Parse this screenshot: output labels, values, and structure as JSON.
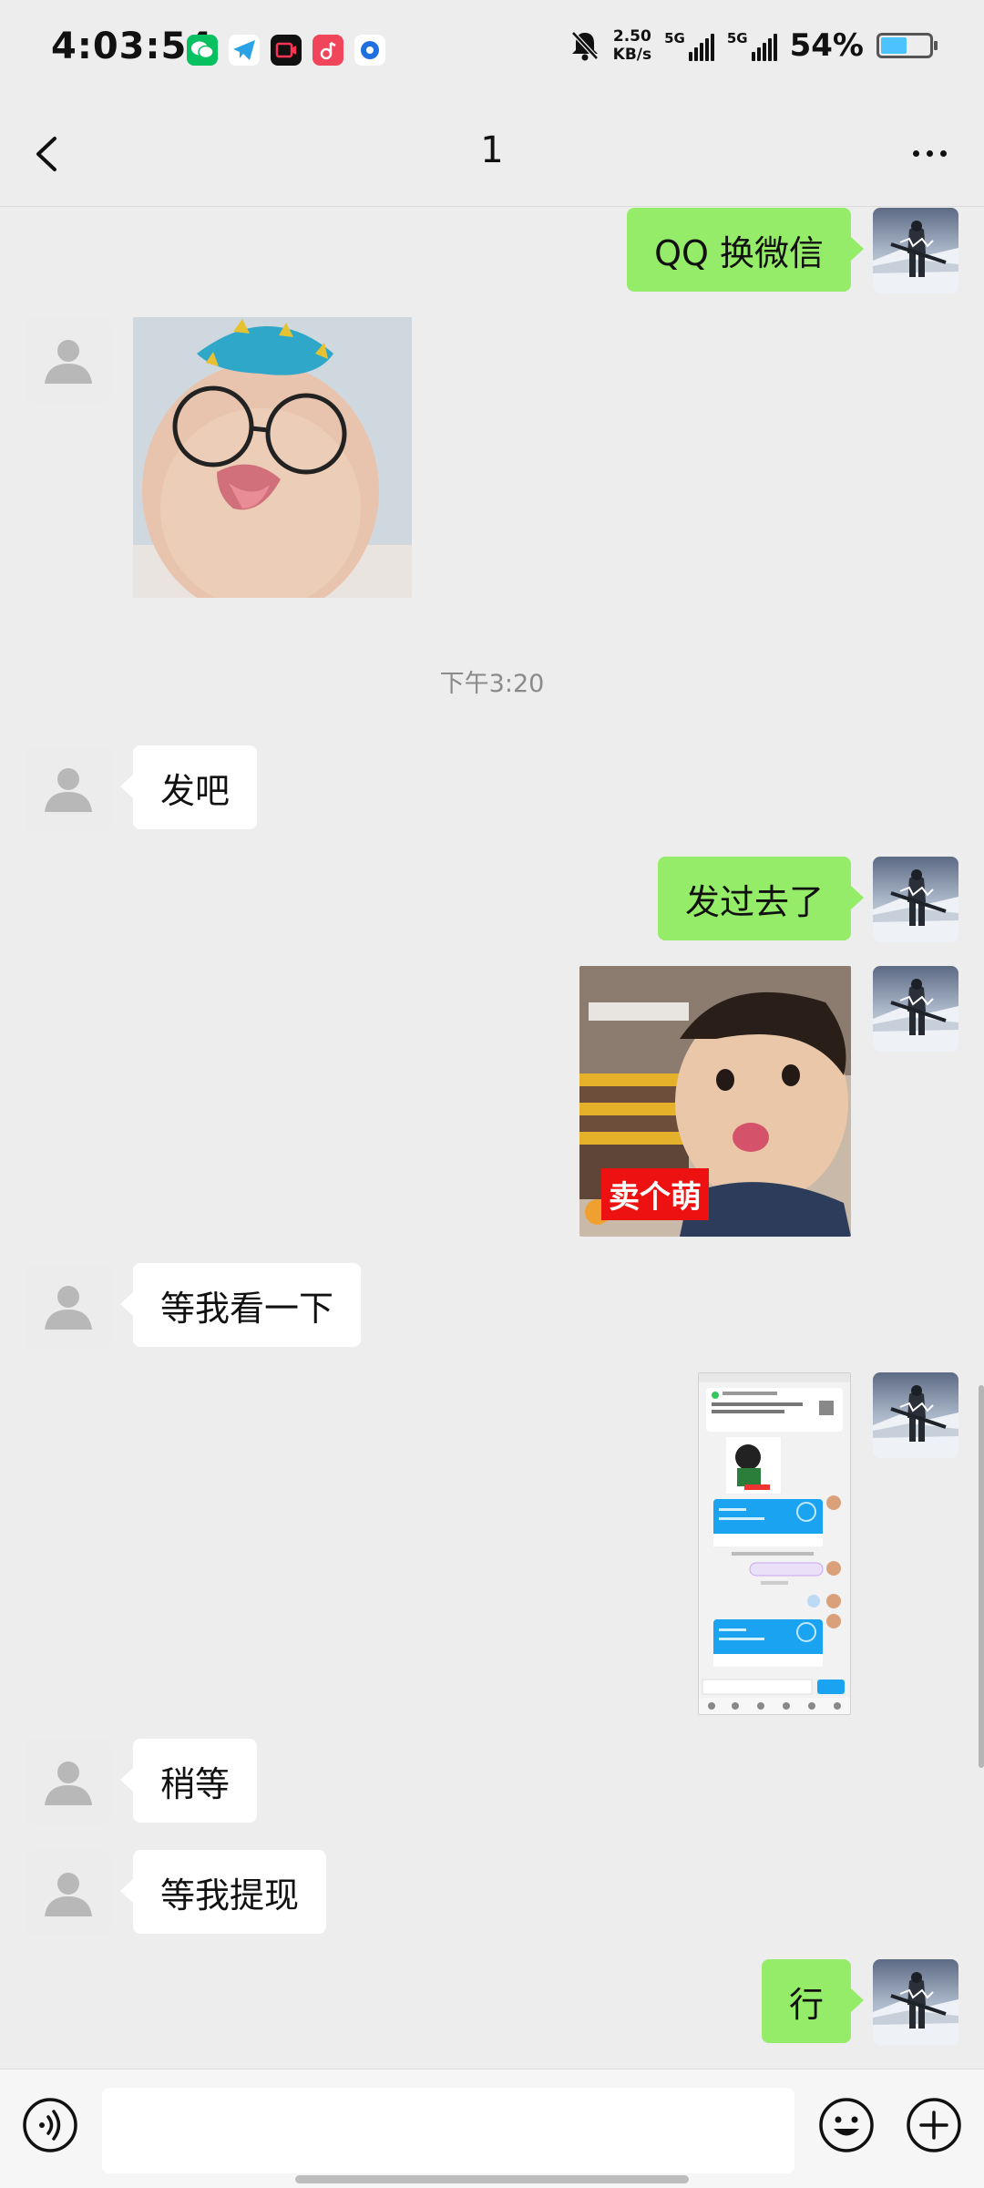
{
  "status_bar": {
    "time": "4:03:54",
    "apps": [
      "wechat-icon",
      "telegram-icon",
      "video-app-icon",
      "music-app-icon",
      "camera-app-icon"
    ],
    "net_speed_value": "2.50",
    "net_speed_unit": "KB/s",
    "signal_1_label": "5G",
    "signal_2_label": "5G",
    "battery_percent": "54%",
    "battery_level": 0.54
  },
  "header": {
    "title": "1"
  },
  "messages": [
    {
      "side": "right",
      "type": "text",
      "text": "QQ 换微信"
    },
    {
      "side": "left",
      "type": "image",
      "description": "baby-with-hat-and-glasses-sticker"
    },
    {
      "type": "timestamp",
      "text": "下午3:20"
    },
    {
      "side": "left",
      "type": "text",
      "text": "发吧"
    },
    {
      "side": "right",
      "type": "text",
      "text": "发过去了"
    },
    {
      "side": "right",
      "type": "image",
      "caption": "卖个萌"
    },
    {
      "side": "left",
      "type": "text",
      "text": "等我看一下"
    },
    {
      "side": "right",
      "type": "image",
      "description": "chat-screenshot"
    },
    {
      "side": "left",
      "type": "text",
      "text": "稍等"
    },
    {
      "side": "left",
      "type": "text",
      "text": "等我提现"
    },
    {
      "side": "right",
      "type": "text",
      "text": "行"
    }
  ],
  "input_bar": {
    "voice_icon": "voice-icon",
    "text_value": "",
    "emoji_icon": "emoji-icon",
    "plus_icon": "plus-icon"
  },
  "colors": {
    "background": "#ededed",
    "outgoing_bubble": "#95ec69",
    "incoming_bubble": "#ffffff",
    "timestamp_text": "#8a8a8a",
    "battery_fill": "#4cc3ff"
  }
}
